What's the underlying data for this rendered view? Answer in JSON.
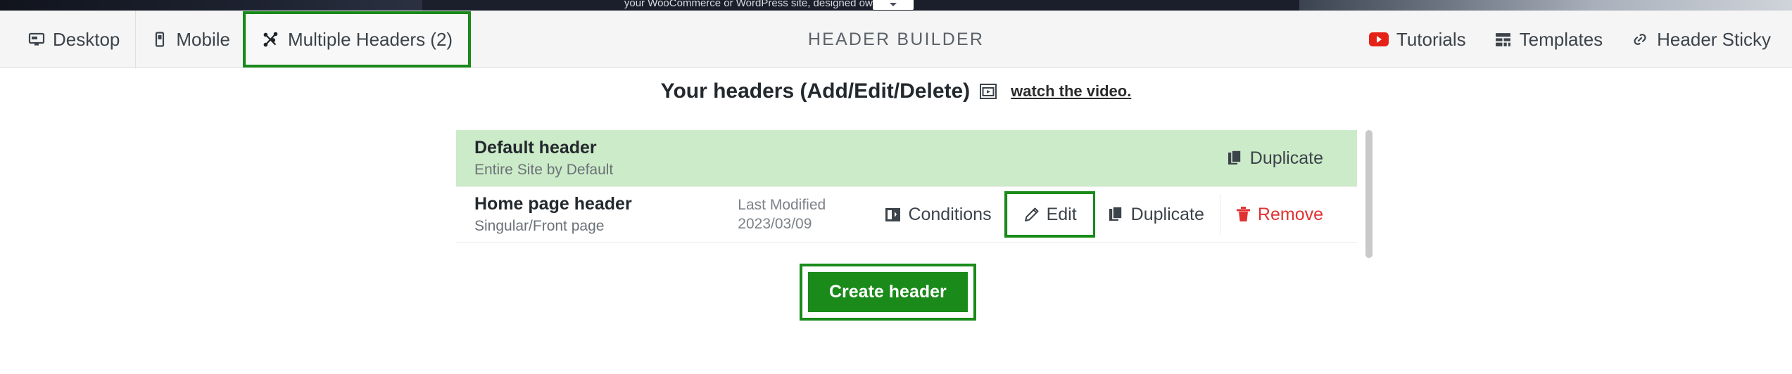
{
  "banner": {
    "text": "your WooCommerce or WordPress site, designed            owerful,"
  },
  "toolbar": {
    "left_items": [
      {
        "label": "Desktop",
        "icon": "desktop-icon",
        "highlighted": false
      },
      {
        "label": "Mobile",
        "icon": "mobile-icon",
        "highlighted": false
      },
      {
        "label": "Multiple Headers (2)",
        "icon": "multiple-headers-icon",
        "highlighted": true
      }
    ],
    "title": "HEADER BUILDER",
    "right_items": [
      {
        "label": "Tutorials",
        "icon": "youtube-icon"
      },
      {
        "label": "Templates",
        "icon": "templates-grid-icon"
      },
      {
        "label": "Header Sticky",
        "icon": "link-chain-icon"
      }
    ]
  },
  "main": {
    "heading": "Your headers (Add/Edit/Delete)",
    "heading_icon": "video-frame-icon",
    "watch_link": "watch the video.",
    "headers": [
      {
        "title": "Default header",
        "subtitle": "Entire Site by Default",
        "modified_label": "",
        "modified_date": "",
        "is_default": true,
        "actions": [
          {
            "label": "Duplicate",
            "icon": "duplicate-icon",
            "kind": "duplicate",
            "highlighted": false
          }
        ]
      },
      {
        "title": "Home page header",
        "subtitle": "Singular/Front page",
        "modified_label": "Last Modified",
        "modified_date": "2023/03/09",
        "is_default": false,
        "actions": [
          {
            "label": "Conditions",
            "icon": "conditions-icon",
            "kind": "conditions",
            "highlighted": false
          },
          {
            "label": "Edit",
            "icon": "pencil-icon",
            "kind": "edit",
            "highlighted": true
          },
          {
            "label": "Duplicate",
            "icon": "duplicate-icon",
            "kind": "duplicate",
            "highlighted": false
          },
          {
            "label": "Remove",
            "icon": "trash-icon",
            "kind": "remove",
            "highlighted": false
          }
        ]
      }
    ],
    "create_button": "Create header"
  },
  "colors": {
    "green_accent": "#1a8a1a",
    "default_row_bg": "#ccebc9",
    "remove_red": "#e03232",
    "toolbar_bg": "#f5f5f5"
  }
}
